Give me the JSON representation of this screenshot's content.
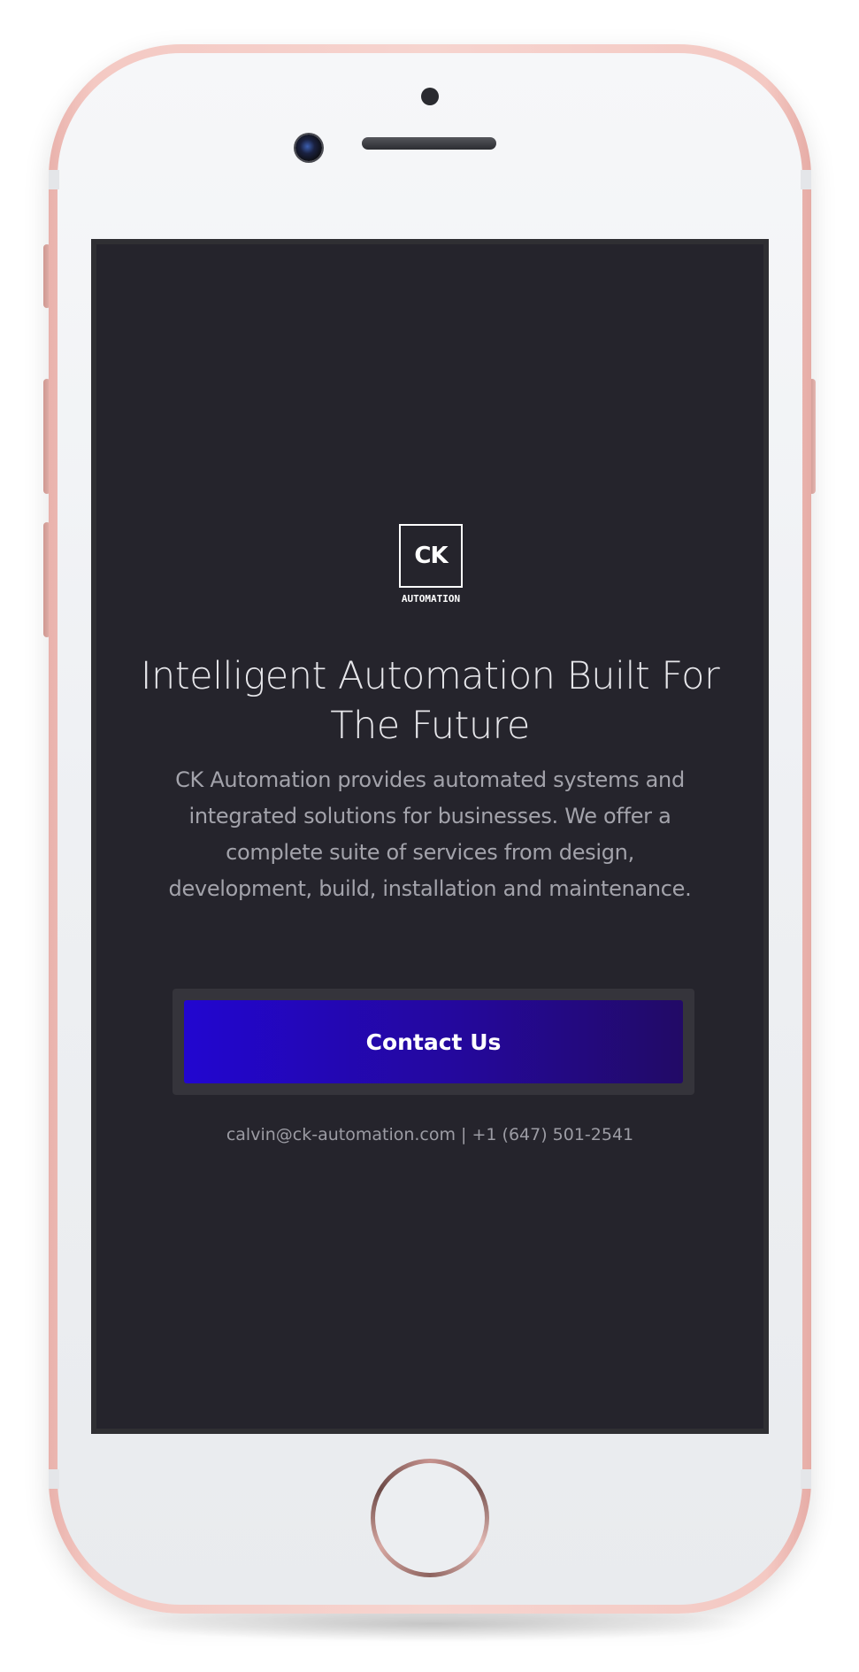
{
  "device": {
    "frame": "iphone-rose-gold",
    "accent_colors": {
      "frame": "#f4c9c3",
      "screen_bg": "#25242c",
      "cta_start": "#2206d0",
      "cta_end": "#220a66"
    }
  },
  "logo": {
    "mark": "CK",
    "subtitle": "AUTOMATION"
  },
  "hero": {
    "headline": "Intelligent Automation Built For The Future",
    "description": "CK Automation provides automated systems and integrated solutions for businesses. We offer a complete suite of services from design, development, build, installation and maintenance."
  },
  "cta": {
    "label": "Contact Us"
  },
  "contact": {
    "line": "calvin@ck-automation.com | +1 (647) 501-2541"
  }
}
